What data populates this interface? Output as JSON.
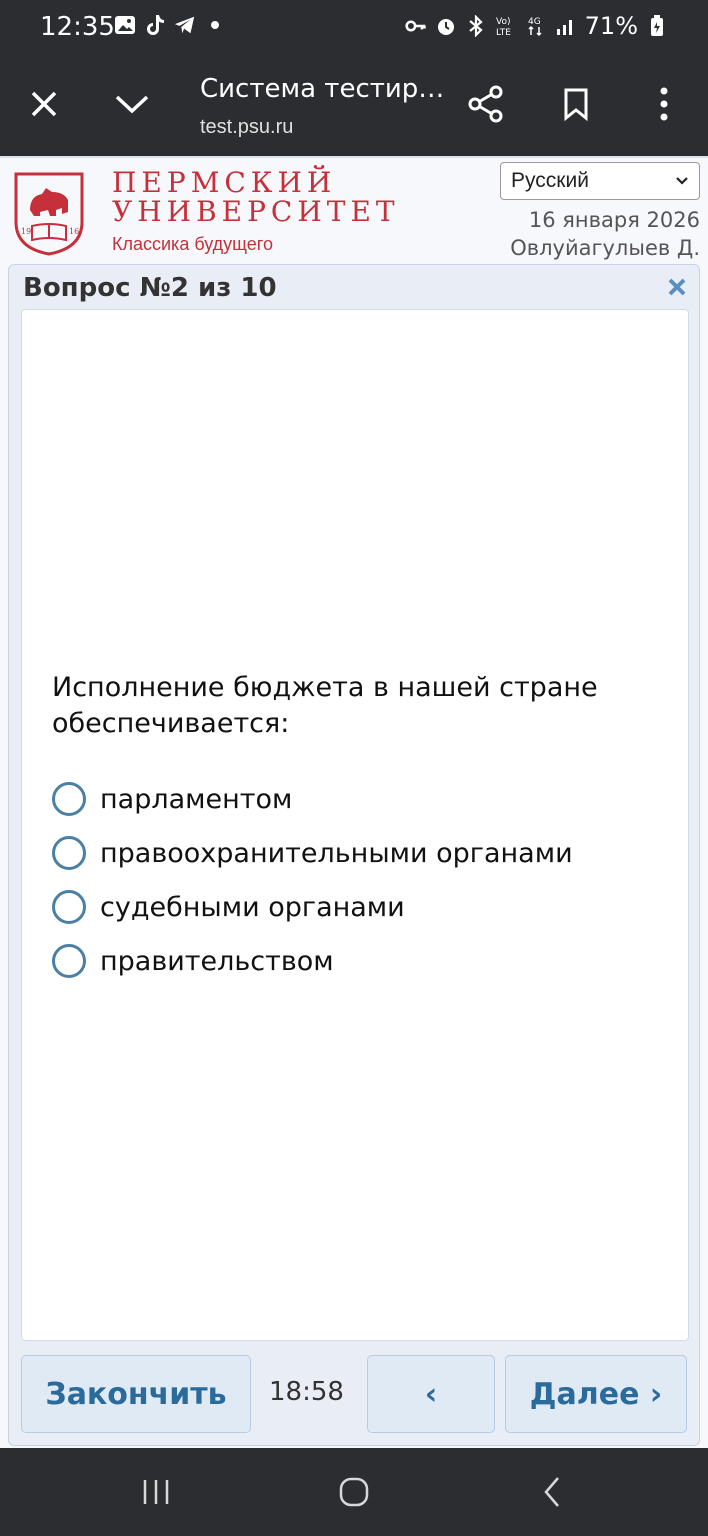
{
  "status_bar": {
    "time": "12:35",
    "battery": "71%",
    "icons": [
      "image-icon",
      "tiktok-icon",
      "telegram-icon",
      "dot-icon",
      "key-icon",
      "alarm-icon",
      "bluetooth-icon",
      "volte-icon",
      "4g-icon",
      "signal-icon",
      "battery-icon"
    ]
  },
  "browser": {
    "title": "Система тестир…",
    "url": "test.psu.ru"
  },
  "header": {
    "university_line1": "ПЕРМСКИЙ",
    "university_line2": "УНИВЕРСИТЕТ",
    "slogan": "Классика будущего",
    "logo_years": [
      "19",
      "16"
    ],
    "language": "Русский",
    "date": "16 января 2026",
    "user": "Овлуйагулыев Д."
  },
  "question": {
    "header": "Вопрос №2 из 10",
    "text": "Исполнение бюджета в нашей стране обеспечивается:",
    "options": [
      {
        "label": "парламентом"
      },
      {
        "label": "правоохранительными органами"
      },
      {
        "label": "судебными органами"
      },
      {
        "label": "правительством"
      }
    ]
  },
  "footer": {
    "finish_label": "Закончить",
    "timer": "18:58",
    "prev_label": "‹",
    "next_label": "Далее ›"
  },
  "colors": {
    "brand_red": "#c6303a",
    "accent_blue": "#2a6b9b"
  }
}
